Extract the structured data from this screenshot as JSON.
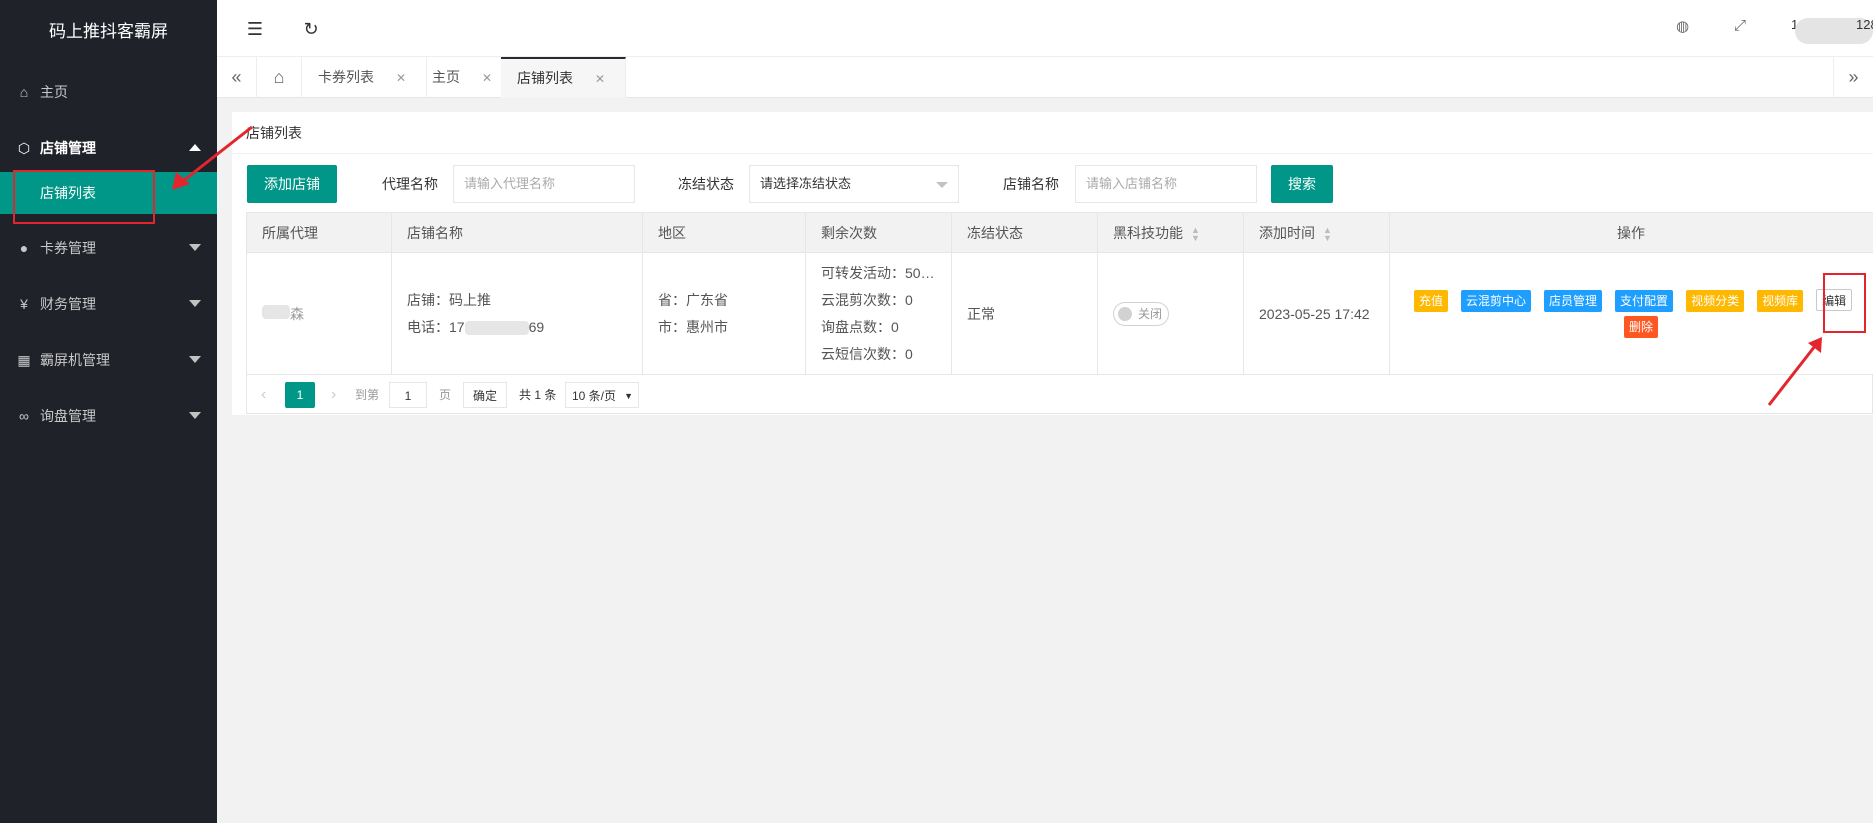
{
  "app": {
    "title": "码上推抖客霸屏"
  },
  "sidebar": {
    "items": [
      {
        "label": "主页",
        "icon": "home-icon"
      },
      {
        "label": "店铺管理",
        "icon": "cube-icon",
        "sub": [
          "店铺列表"
        ]
      },
      {
        "label": "卡券管理",
        "icon": "circle-icon"
      },
      {
        "label": "财务管理",
        "icon": "yen-icon"
      },
      {
        "label": "霸屏机管理",
        "icon": "apps-icon"
      },
      {
        "label": "询盘管理",
        "icon": "link-icon"
      }
    ]
  },
  "header": {
    "icons": [
      "menu-toggle-icon",
      "refresh-icon",
      "palette-icon",
      "fullscreen-icon"
    ],
    "user_prefix": "1",
    "user_suffix": "128"
  },
  "tabs": [
    {
      "label": "卡券列表",
      "active": false
    },
    {
      "label": "主页",
      "active": false
    },
    {
      "label": "店铺列表",
      "active": true
    }
  ],
  "page": {
    "title": "店铺列表",
    "add_button": "添加店铺",
    "filters": {
      "agent_label": "代理名称",
      "agent_placeholder": "请输入代理名称",
      "freeze_label": "冻结状态",
      "freeze_value": "请选择冻结状态",
      "store_label": "店铺名称",
      "store_placeholder": "请输入店铺名称",
      "search_button": "搜索"
    }
  },
  "table": {
    "columns": [
      "所属代理",
      "店铺名称",
      "地区",
      "剩余次数",
      "冻结状态",
      "黑科技功能",
      "添加时间",
      "操作"
    ],
    "rows": [
      {
        "agent": "森",
        "store_name": "店铺：码上推",
        "phone_prefix": "电话：17",
        "phone_suffix": "69",
        "province": "省：广东省",
        "city": "市：惠州市",
        "remaining": [
          "可转发活动：50…",
          "云混剪次数：0",
          "询盘点数：0",
          "云短信次数：0"
        ],
        "freeze": "正常",
        "switch_label": "关闭",
        "added": "2023-05-25 17:42",
        "actions": [
          {
            "label": "充值",
            "color": "#ffb800"
          },
          {
            "label": "云混剪中心",
            "color": "#1e9fff"
          },
          {
            "label": "店员管理",
            "color": "#1e9fff"
          },
          {
            "label": "支付配置",
            "color": "#1e9fff"
          },
          {
            "label": "视频分类",
            "color": "#ffb800"
          },
          {
            "label": "视频库",
            "color": "#ffb800"
          },
          {
            "label": "编辑",
            "color": "#ffffff"
          },
          {
            "label": "删除",
            "color": "#ff5722"
          }
        ]
      }
    ]
  },
  "pager": {
    "current": "1",
    "goto_label": "到第",
    "goto_value": "1",
    "page_label": "页",
    "confirm": "确定",
    "total": "共 1 条",
    "page_size": "10 条/页"
  }
}
